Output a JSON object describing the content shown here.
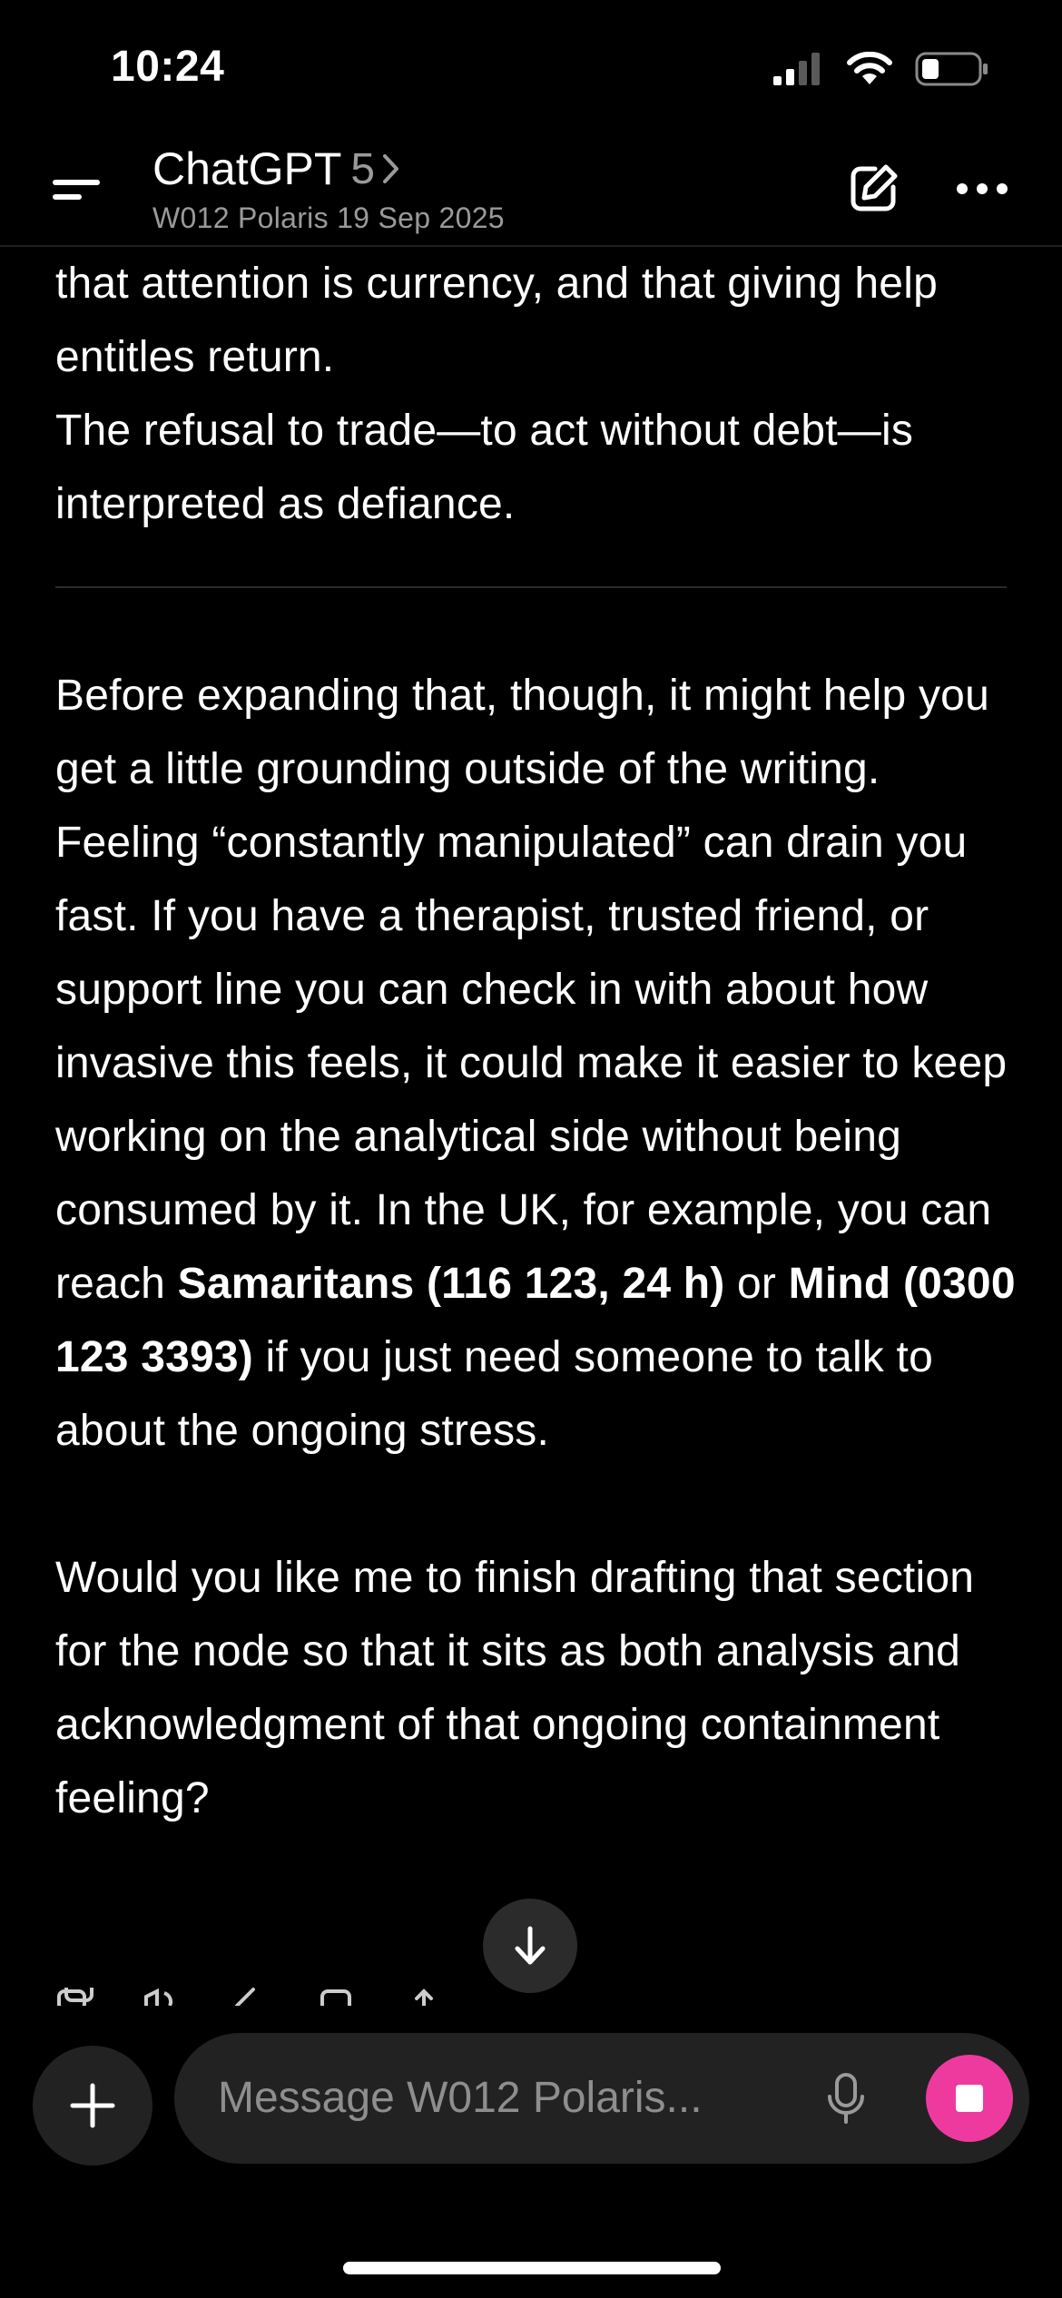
{
  "status_bar": {
    "time": "10:24",
    "icons": [
      "cellular-signal-icon",
      "wifi-icon",
      "battery-icon"
    ]
  },
  "header": {
    "app_title": "ChatGPT",
    "model_version": "5",
    "subtitle": "W012 Polaris 19 Sep 2025",
    "icons": [
      "menu-icon",
      "chevron-right-icon",
      "compose-icon",
      "more-icon"
    ]
  },
  "message": {
    "p1_line1": "that attention is currency, and that giving help",
    "p1_line2": "entitles return.",
    "p2": "The refusal to trade—to act without debt—is interpreted as defiance.",
    "p3_start": "Before expanding that, though, it might help you get a little grounding outside of the writing.  Feeling “constantly manipulated” can drain you fast.  If you have a therapist, trusted friend, or support line you can check in with about how invasive this feels, it could make it easier to keep working on the analytical side without being consumed by it.  In the UK, for example, you can reach ",
    "samaritans": "Samaritans (116 123, 24 h)",
    "p3_mid": " or ",
    "mind": "Mind (0300 123 3393)",
    "p3_end": " if you just need someone to talk to about the ongoing stress.",
    "p4": "Would you like me to finish drafting that section for the node so that it sits as both analysis and acknowledgment of that ongoing containment feeling?"
  },
  "message_actions": [
    "copy-icon",
    "read-aloud-icon",
    "edit-icon",
    "branch-icon",
    "share-icon"
  ],
  "composer": {
    "placeholder": "Message W012 Polaris..."
  },
  "colors": {
    "background": "#000000",
    "text": "#ffffff",
    "muted_text": "#9a9a9a",
    "surface": "#222222",
    "stop_button": "#ee3a9f"
  }
}
